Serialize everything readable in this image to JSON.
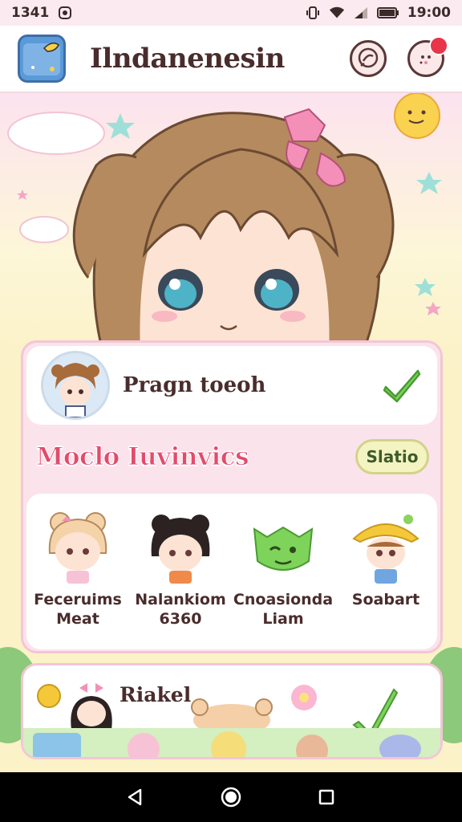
{
  "status_bar": {
    "time": "1341",
    "clock": "19:00",
    "icons": [
      "app-notification-icon",
      "vibrate-icon",
      "wifi-icon",
      "signal-icon",
      "battery-icon"
    ]
  },
  "header": {
    "app_title": "Ilndanenesin",
    "icons": [
      "app-logo-icon",
      "chat-icon",
      "profile-icon"
    ]
  },
  "profile": {
    "name": "Pragn toeoh"
  },
  "section": {
    "title": "Moclo Iuvinvics",
    "status_label": "Slatio"
  },
  "friends": [
    {
      "name": "Feceruims",
      "sub": "Meat"
    },
    {
      "name": "Nalankiom",
      "sub": "6360"
    },
    {
      "name": "Cnoasionda",
      "sub": "Liam"
    },
    {
      "name": "Soabart",
      "sub": ""
    }
  ],
  "second_card": {
    "title": "Riakel"
  },
  "colors": {
    "accent_pink": "#e24b6c",
    "check_green": "#6cc24a",
    "notif_red": "#e8354a"
  },
  "nav": [
    "back-icon",
    "home-icon",
    "recents-icon"
  ]
}
